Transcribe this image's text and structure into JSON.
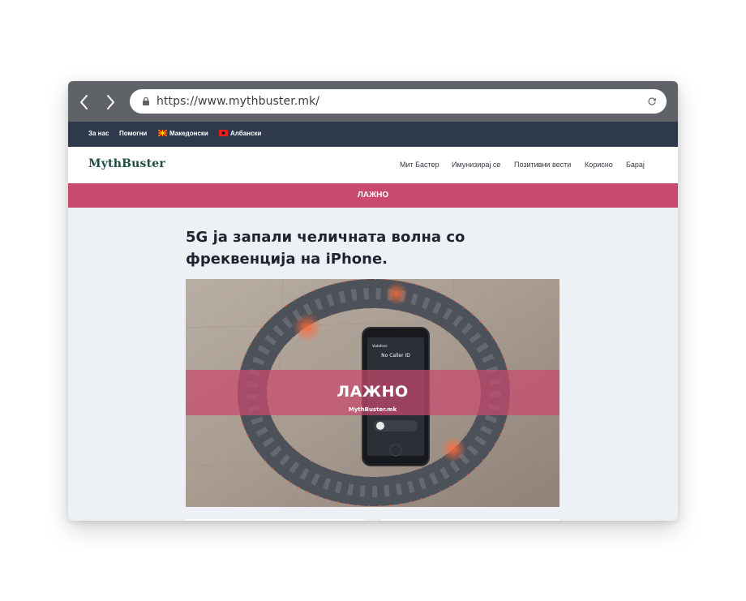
{
  "browser": {
    "url": "https://www.mythbuster.mk/"
  },
  "topbar": {
    "links": [
      "За нас",
      "Помогни"
    ],
    "languages": [
      {
        "label": "Македонски",
        "flag_color": "#d20000"
      },
      {
        "label": "Албански",
        "flag_color": "#e41e20"
      }
    ]
  },
  "header": {
    "logo": "MythBuster",
    "menu": [
      "Мит Бастер",
      "Имунизирај се",
      "Позитивни вести",
      "Корисно",
      "Барај"
    ]
  },
  "banner": {
    "label": "ЛАЖНО",
    "color": "#c94a6e"
  },
  "article": {
    "title": "5G ја запали челичната волна со фреквенција на iPhone.",
    "image": {
      "stamp": "ЛАЖНО",
      "watermark": "MythBuster.mk",
      "phone_screen": {
        "carrier": "Vodafone",
        "caller": "No Caller ID"
      }
    }
  },
  "colors": {
    "chrome": "#5f6368",
    "topbar": "#2e3a4b",
    "page_bg": "#edf1f6",
    "logo": "#1d4d43"
  }
}
